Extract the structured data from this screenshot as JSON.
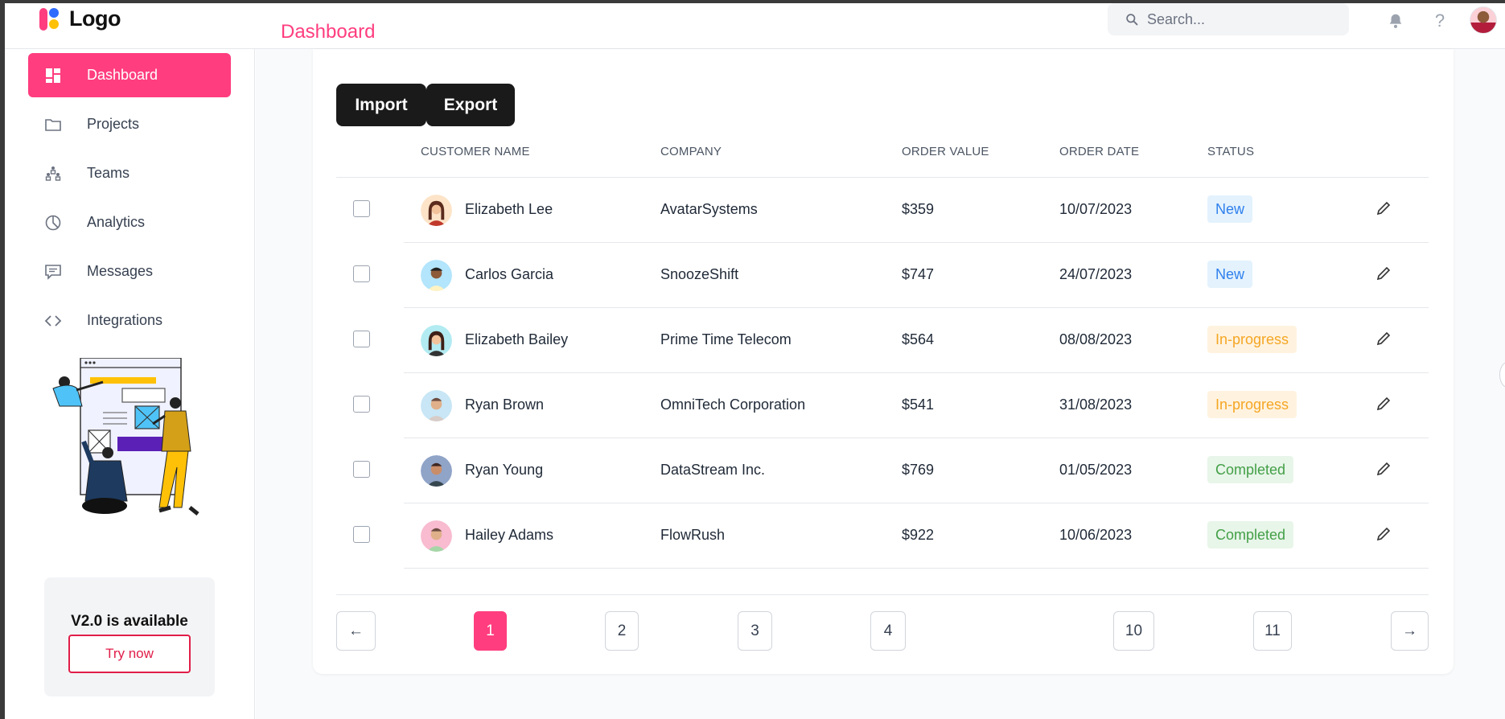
{
  "header": {
    "logo_text": "Logo",
    "page_title": "Dashboard",
    "search_placeholder": "Search..."
  },
  "sidebar": {
    "items": [
      {
        "label": "Dashboard",
        "icon": "dashboard-icon",
        "active": true
      },
      {
        "label": "Projects",
        "icon": "folder-icon"
      },
      {
        "label": "Teams",
        "icon": "teams-icon"
      },
      {
        "label": "Analytics",
        "icon": "pie-chart-icon"
      },
      {
        "label": "Messages",
        "icon": "message-icon"
      },
      {
        "label": "Integrations",
        "icon": "code-icon"
      }
    ],
    "promo": {
      "title": "V2.0 is available",
      "button": "Try now"
    }
  },
  "toolbar": {
    "import_label": "Import",
    "export_label": "Export"
  },
  "table": {
    "columns": [
      "CUSTOMER NAME",
      "COMPANY",
      "ORDER VALUE",
      "ORDER DATE",
      "STATUS"
    ],
    "rows": [
      {
        "name": "Elizabeth Lee",
        "company": "AvatarSystems",
        "value": "$359",
        "date": "10/07/2023",
        "status": "New"
      },
      {
        "name": "Carlos Garcia",
        "company": "SnoozeShift",
        "value": "$747",
        "date": "24/07/2023",
        "status": "New"
      },
      {
        "name": "Elizabeth Bailey",
        "company": "Prime Time Telecom",
        "value": "$564",
        "date": "08/08/2023",
        "status": "In-progress"
      },
      {
        "name": "Ryan Brown",
        "company": "OmniTech Corporation",
        "value": "$541",
        "date": "31/08/2023",
        "status": "In-progress"
      },
      {
        "name": "Ryan Young",
        "company": "DataStream Inc.",
        "value": "$769",
        "date": "01/05/2023",
        "status": "Completed"
      },
      {
        "name": "Hailey Adams",
        "company": "FlowRush",
        "value": "$922",
        "date": "10/06/2023",
        "status": "Completed"
      }
    ]
  },
  "pagination": {
    "prev": "←",
    "next": "→",
    "pages": [
      "1",
      "2",
      "3",
      "4",
      "10",
      "11"
    ],
    "current": "1"
  },
  "colors": {
    "accent": "#ff3d7f",
    "status_new": "#2f80ed",
    "status_progress": "#f5a623",
    "status_completed": "#43a047"
  }
}
